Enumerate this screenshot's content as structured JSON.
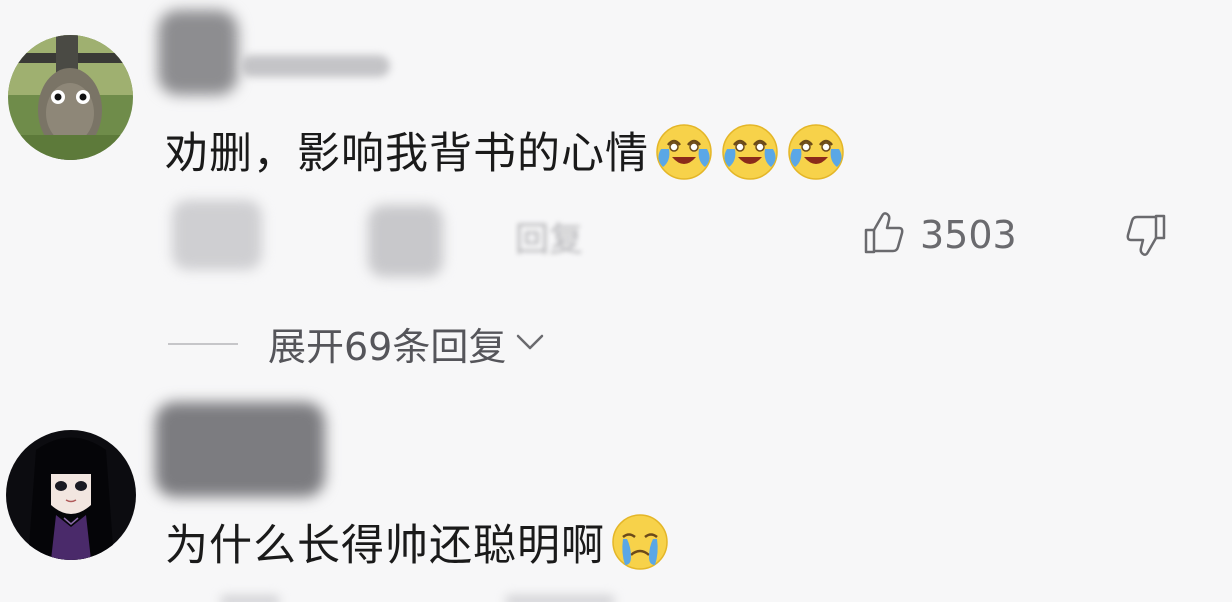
{
  "comments": [
    {
      "text": "劝删，影响我背书的心情",
      "emoji_count": 3,
      "emoji": "laughing-crying-emoji",
      "reply_label": "回复",
      "likes": "3503",
      "expand_label": "展开69条回复"
    },
    {
      "text": "为什么长得帅还聪明啊",
      "emoji": "crying-emoji"
    }
  ],
  "colors": {
    "background": "#f7f7f8",
    "text": "#1a1a1a",
    "muted": "#6a6a6e",
    "emoji_yellow": "#f7d24a",
    "emoji_tear": "#5aa7e6"
  },
  "icons": {
    "like": "thumbs-up-icon",
    "dislike": "thumbs-down-icon",
    "expand": "chevron-down-icon"
  }
}
